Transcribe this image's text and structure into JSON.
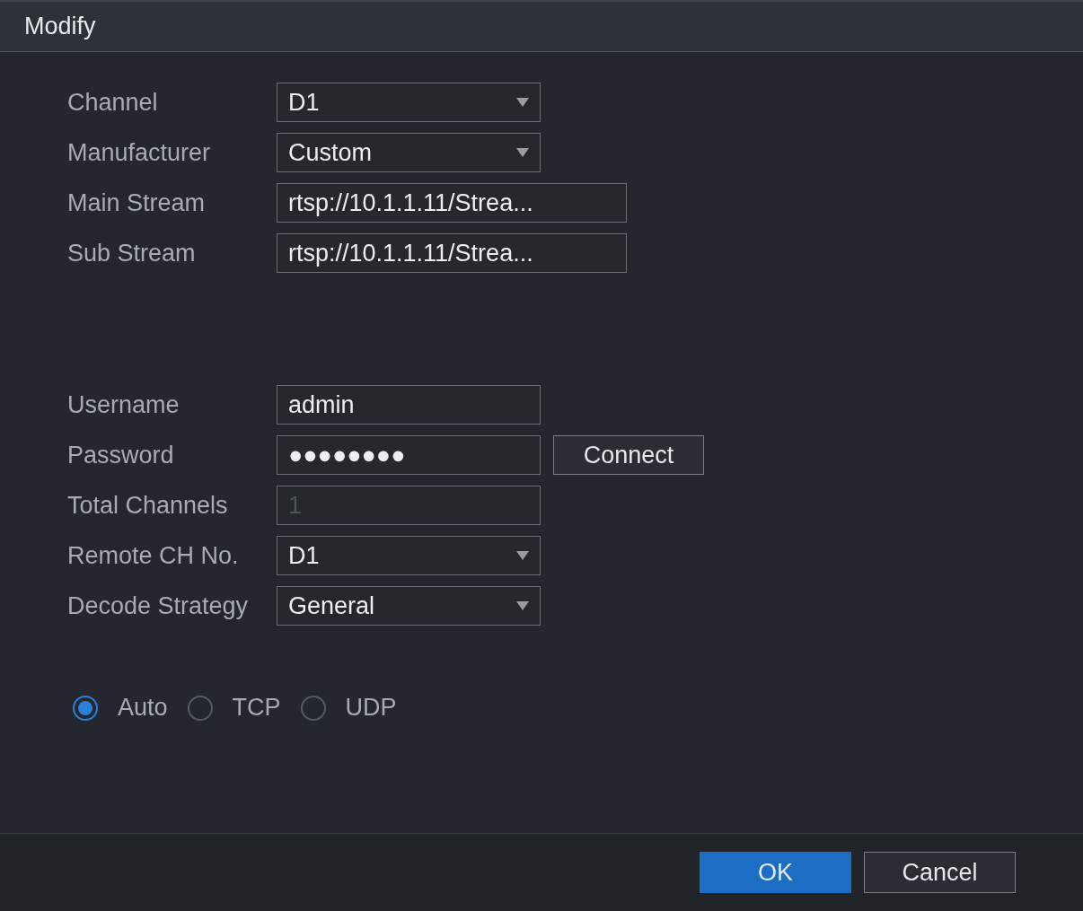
{
  "window": {
    "title": "Modify"
  },
  "fields": [
    {
      "kind": "select",
      "label": "Channel",
      "value": "D1",
      "disabled": false,
      "wide": false
    },
    {
      "kind": "select",
      "label": "Manufacturer",
      "value": "Custom",
      "disabled": false,
      "wide": false
    },
    {
      "kind": "text",
      "label": "Main Stream",
      "value": "rtsp://10.1.1.11/Strea...",
      "disabled": false,
      "wide": true
    },
    {
      "kind": "text",
      "label": "Sub Stream",
      "value": "rtsp://10.1.1.11/Strea...",
      "disabled": false,
      "wide": true
    }
  ],
  "credentials": [
    {
      "kind": "text",
      "label": "Username",
      "value": "admin",
      "disabled": false,
      "wide": false
    },
    {
      "kind": "password",
      "label": "Password",
      "value": "●●●●●●●●",
      "disabled": false,
      "wide": false,
      "button": "Connect"
    },
    {
      "kind": "text",
      "label": "Total Channels",
      "value": "1",
      "disabled": true,
      "wide": false
    },
    {
      "kind": "select",
      "label": "Remote CH No.",
      "value": "D1",
      "disabled": false,
      "wide": false
    },
    {
      "kind": "select",
      "label": "Decode Strategy",
      "value": "General",
      "disabled": false,
      "wide": false
    }
  ],
  "protocol": [
    {
      "label": "Auto",
      "selected": true
    },
    {
      "label": "TCP",
      "selected": false
    },
    {
      "label": "UDP",
      "selected": false
    }
  ],
  "buttons": [
    {
      "label": "OK",
      "kind": "primary"
    },
    {
      "label": "Cancel",
      "kind": "secondary"
    }
  ]
}
